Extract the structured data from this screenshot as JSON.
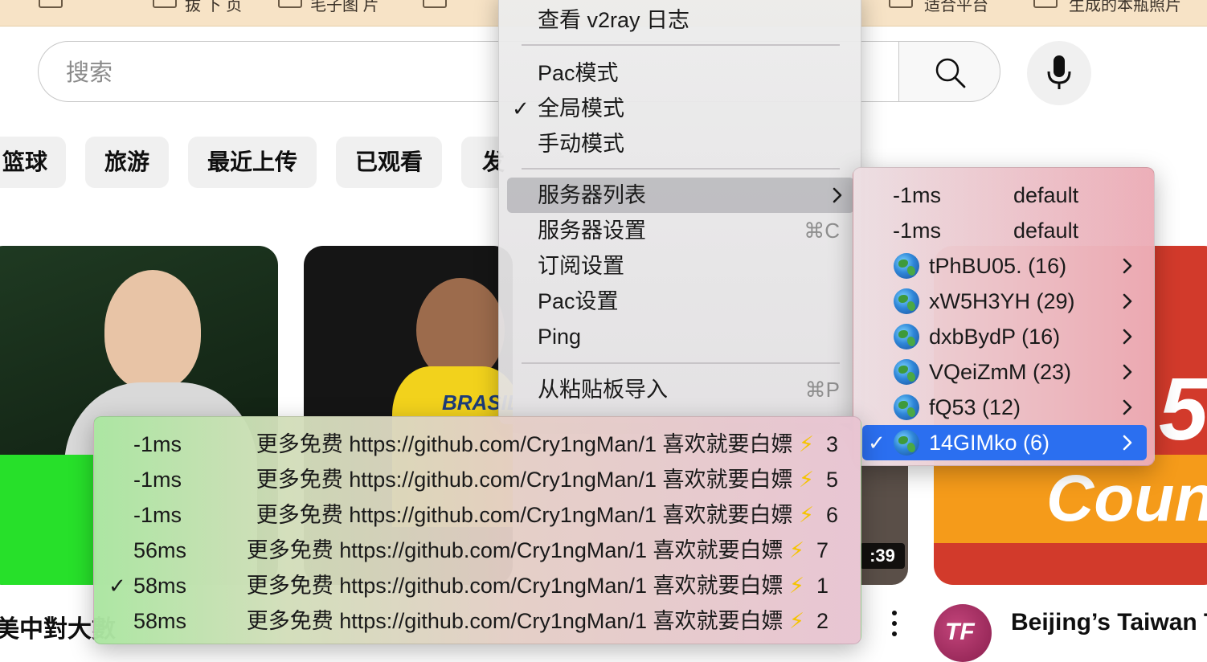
{
  "background": {
    "bookmarks": [
      "",
      "拔 下 页",
      "毛子图 片",
      "",
      "适合平台",
      "生成的本瓶照片"
    ],
    "search": {
      "placeholder": "搜索"
    },
    "chips": [
      "篮球",
      "旅游",
      "最近上传",
      "已观看",
      "发"
    ],
    "video_titles": [
      "美中對大數",
      "Beijing’s Taiwan T"
    ],
    "channel_avatar_text": "TF",
    "thumbnail_texts": {
      "brasil": "BRASIL",
      "time": ":39",
      "coun": "Coun",
      "five": "5"
    }
  },
  "main_menu": {
    "items": [
      {
        "label": "查看 v2ray 日志"
      },
      {
        "label": "Pac模式"
      },
      {
        "label": "全局模式",
        "checked": true,
        "check": "✓"
      },
      {
        "label": "手动模式"
      },
      {
        "label": "服务器列表",
        "highlighted": true
      },
      {
        "label": "服务器设置",
        "shortcut": "⌘C"
      },
      {
        "label": "订阅设置"
      },
      {
        "label": "Pac设置"
      },
      {
        "label": "Ping"
      },
      {
        "label": "从粘贴板导入",
        "shortcut": "⌘P"
      }
    ]
  },
  "server_menu": {
    "items": [
      {
        "latency": "-1ms",
        "group": "default"
      },
      {
        "latency": "-1ms",
        "group": "default"
      },
      {
        "name": "tPhBU05. (16)"
      },
      {
        "name": "xW5H3YH (29)"
      },
      {
        "name": "dxbBydP (16)"
      },
      {
        "name": "VQeiZmM (23)"
      },
      {
        "name": "fQ53 (12)"
      },
      {
        "name": "14GIMko (6)",
        "selected": true,
        "check": "✓"
      }
    ]
  },
  "node_menu": {
    "items": [
      {
        "latency": "-1ms",
        "desc": "更多免费 https://github.com/Cry1ngMan/1 喜欢就要白嫖",
        "bolt": "⚡",
        "num": "3"
      },
      {
        "latency": "-1ms",
        "desc": "更多免费 https://github.com/Cry1ngMan/1 喜欢就要白嫖",
        "bolt": "⚡",
        "num": "5"
      },
      {
        "latency": "-1ms",
        "desc": "更多免费 https://github.com/Cry1ngMan/1 喜欢就要白嫖",
        "bolt": "⚡",
        "num": "6"
      },
      {
        "latency": "56ms",
        "desc": "更多免费 https://github.com/Cry1ngMan/1 喜欢就要白嫖",
        "bolt": "⚡",
        "num": "7"
      },
      {
        "latency": "58ms",
        "desc": "更多免费 https://github.com/Cry1ngMan/1 喜欢就要白嫖",
        "bolt": "⚡",
        "num": "1",
        "checked": true,
        "check": "✓"
      },
      {
        "latency": "58ms",
        "desc": "更多免费 https://github.com/Cry1ngMan/1 喜欢就要白嫖",
        "bolt": "⚡",
        "num": "2"
      }
    ]
  },
  "colors": {
    "selection": "#2b6ff0",
    "bolt": "#f5c400"
  }
}
